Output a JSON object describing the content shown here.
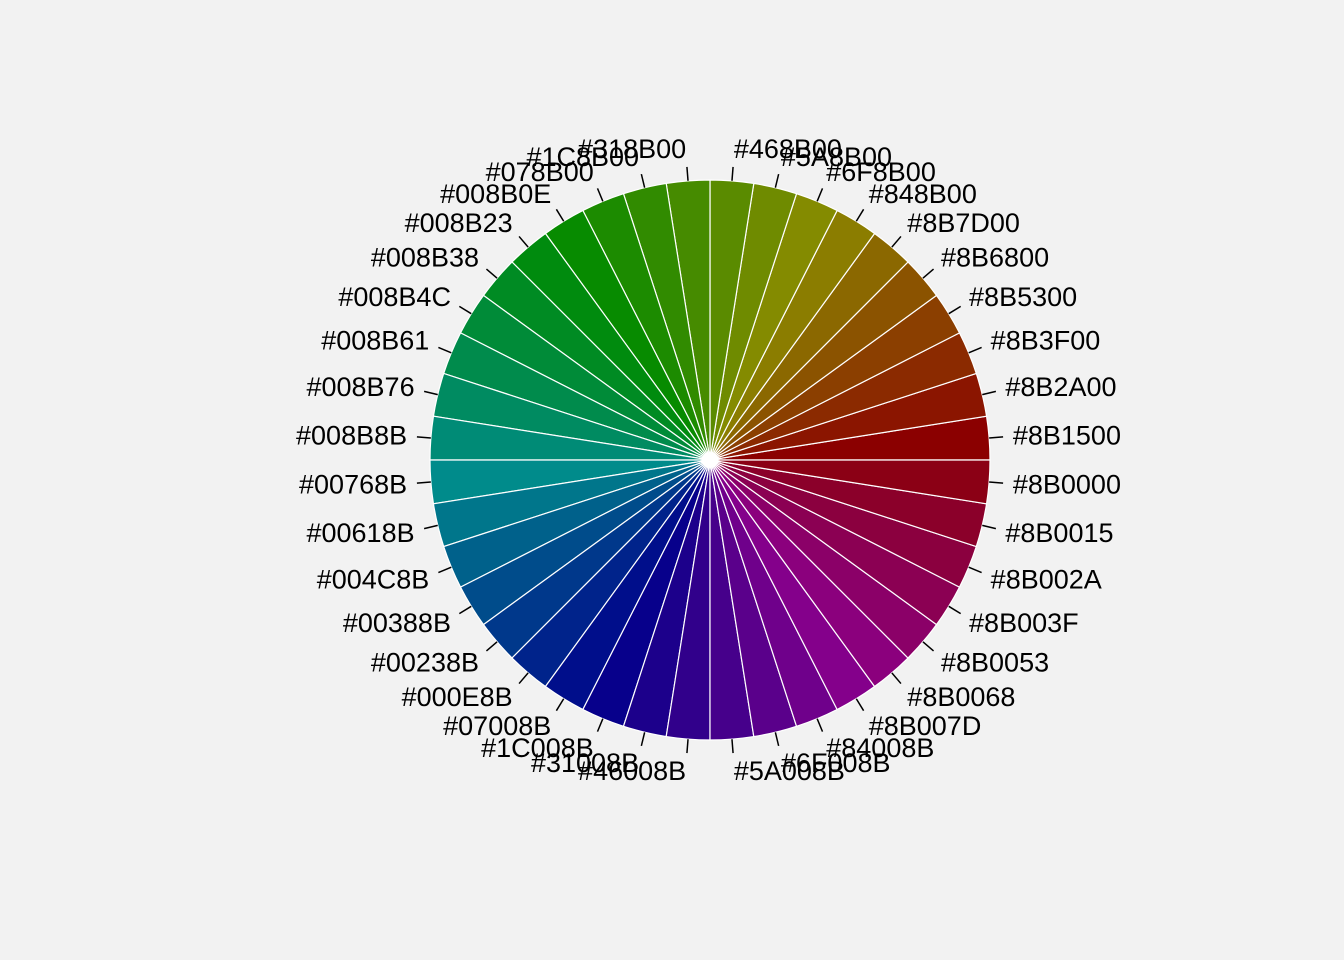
{
  "chart_data": {
    "type": "pie",
    "title": "",
    "direction": "counterclockwise",
    "start": "right",
    "categories": [
      "#8B0000",
      "#8B1500",
      "#8B2A00",
      "#8B3F00",
      "#8B5300",
      "#8B6800",
      "#8B7D00",
      "#848B00",
      "#6F8B00",
      "#5A8B00",
      "#468B00",
      "#318B00",
      "#1C8B00",
      "#078B00",
      "#008B0E",
      "#008B23",
      "#008B38",
      "#008B4C",
      "#008B61",
      "#008B76",
      "#008B8B",
      "#00768B",
      "#00618B",
      "#004C8B",
      "#00388B",
      "#00238B",
      "#000E8B",
      "#07008B",
      "#1C008B",
      "#31008B",
      "#46008B",
      "#5A008B",
      "#6F008B",
      "#84008B",
      "#8B007D",
      "#8B0068",
      "#8B0053",
      "#8B003F",
      "#8B002A",
      "#8B0015"
    ],
    "labels": [
      "#8B1500",
      "#8B2A00",
      "#8B3F00",
      "#8B5300",
      "#8B6800",
      "#8B7D00",
      "#848B00",
      "#6F8B00",
      "#5A8B00",
      "#468B00",
      "#318B00",
      "#1C8B00",
      "#078B00",
      "#008B0E",
      "#008B23",
      "#008B38",
      "#008B4C",
      "#008B61",
      "#008B76",
      "#008B8B",
      "#00768B",
      "#00618B",
      "#004C8B",
      "#00388B",
      "#00238B",
      "#000E8B",
      "#07008B",
      "#1C008B",
      "#31008B",
      "#46008B",
      "#5A008B",
      "#6F008B",
      "#84008B",
      "#8B007D",
      "#8B0068",
      "#8B0053",
      "#8B003F",
      "#8B002A",
      "#8B0015",
      "#8B0000"
    ],
    "values": [
      1,
      1,
      1,
      1,
      1,
      1,
      1,
      1,
      1,
      1,
      1,
      1,
      1,
      1,
      1,
      1,
      1,
      1,
      1,
      1,
      1,
      1,
      1,
      1,
      1,
      1,
      1,
      1,
      1,
      1,
      1,
      1,
      1,
      1,
      1,
      1,
      1,
      1,
      1,
      1
    ]
  }
}
